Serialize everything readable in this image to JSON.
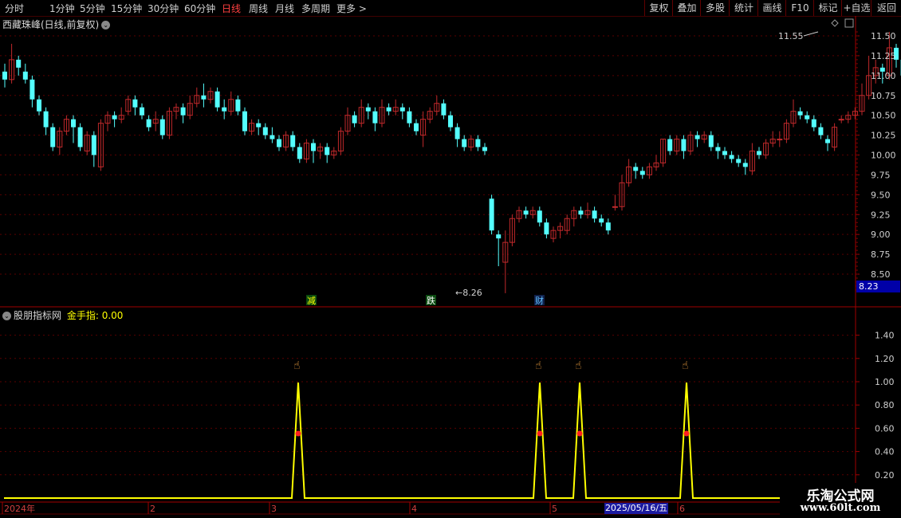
{
  "toolbar": {
    "periods": [
      "分时",
      "1分钟",
      "5分钟",
      "15分钟",
      "30分钟",
      "60分钟",
      "日线",
      "周线",
      "月线",
      "多周期",
      "更多 >"
    ],
    "active_period": "日线",
    "right_buttons": [
      "复权",
      "叠加",
      "多股",
      "统计",
      "画线",
      "F10",
      "标记",
      "+自选",
      "返回"
    ]
  },
  "main_chart": {
    "title": "西藏珠峰(日线,前复权)",
    "y_ticks": [
      "11.50",
      "11.25",
      "11.00",
      "10.75",
      "10.50",
      "10.25",
      "10.00",
      "9.75",
      "9.50",
      "9.25",
      "9.00",
      "8.75",
      "8.50"
    ],
    "high_label": "11.55",
    "low_label": "8.26",
    "current_price": "8.23",
    "markers": [
      "减",
      "跌",
      "财"
    ]
  },
  "indicator": {
    "name": "股朋指标网",
    "value_label": "金手指: 0.00",
    "y_ticks": [
      "1.40",
      "1.20",
      "1.00",
      "0.80",
      "0.60",
      "0.40",
      "0.20"
    ]
  },
  "time_axis": {
    "labels": [
      "2024年",
      "2",
      "3",
      "4",
      "5",
      "6"
    ],
    "cursor_date": "2025/05/16/五"
  },
  "watermark": {
    "line1": "乐淘公式网",
    "line2": "www.60lt.com"
  },
  "chart_data": {
    "type": "candlestick",
    "title": "西藏珠峰(日线,前复权)",
    "ylim": [
      8.23,
      11.6
    ],
    "candles": [
      [
        11.05,
        10.95,
        11.15,
        10.85
      ],
      [
        10.95,
        11.2,
        11.4,
        10.9
      ],
      [
        11.2,
        11.1,
        11.25,
        11.0
      ],
      [
        11.05,
        10.95,
        11.15,
        10.9
      ],
      [
        10.95,
        10.7,
        11.0,
        10.6
      ],
      [
        10.7,
        10.55,
        10.75,
        10.5
      ],
      [
        10.55,
        10.35,
        10.6,
        10.25
      ],
      [
        10.35,
        10.1,
        10.4,
        10.05
      ],
      [
        10.1,
        10.3,
        10.35,
        10.0
      ],
      [
        10.3,
        10.45,
        10.5,
        10.25
      ],
      [
        10.45,
        10.35,
        10.5,
        10.15
      ],
      [
        10.35,
        10.1,
        10.4,
        10.05
      ],
      [
        10.05,
        10.25,
        10.3,
        10.0
      ],
      [
        10.25,
        10.0,
        10.3,
        9.85
      ],
      [
        9.85,
        10.4,
        10.45,
        9.8
      ],
      [
        10.4,
        10.5,
        10.55,
        10.3
      ],
      [
        10.5,
        10.45,
        10.55,
        10.35
      ],
      [
        10.45,
        10.5,
        10.6,
        10.4
      ],
      [
        10.55,
        10.7,
        10.75,
        10.5
      ],
      [
        10.7,
        10.6,
        10.75,
        10.5
      ],
      [
        10.6,
        10.5,
        10.65,
        10.45
      ],
      [
        10.45,
        10.35,
        10.5,
        10.3
      ],
      [
        10.4,
        10.45,
        10.55,
        10.3
      ],
      [
        10.45,
        10.25,
        10.5,
        10.2
      ],
      [
        10.25,
        10.55,
        10.6,
        10.2
      ],
      [
        10.55,
        10.6,
        10.65,
        10.45
      ],
      [
        10.6,
        10.5,
        10.65,
        10.4
      ],
      [
        10.5,
        10.65,
        10.75,
        10.45
      ],
      [
        10.65,
        10.75,
        10.85,
        10.6
      ],
      [
        10.75,
        10.7,
        10.9,
        10.6
      ],
      [
        10.7,
        10.8,
        10.85,
        10.65
      ],
      [
        10.8,
        10.6,
        10.85,
        10.55
      ],
      [
        10.6,
        10.55,
        10.7,
        10.45
      ],
      [
        10.55,
        10.7,
        10.8,
        10.5
      ],
      [
        10.7,
        10.55,
        10.75,
        10.5
      ],
      [
        10.55,
        10.3,
        10.6,
        10.25
      ],
      [
        10.3,
        10.4,
        10.45,
        10.25
      ],
      [
        10.4,
        10.35,
        10.45,
        10.25
      ],
      [
        10.35,
        10.25,
        10.4,
        10.2
      ],
      [
        10.25,
        10.2,
        10.35,
        10.15
      ],
      [
        10.2,
        10.1,
        10.25,
        10.05
      ],
      [
        10.1,
        10.25,
        10.3,
        10.05
      ],
      [
        10.25,
        10.1,
        10.3,
        10.05
      ],
      [
        10.1,
        9.95,
        10.15,
        9.9
      ],
      [
        9.95,
        10.15,
        10.2,
        9.9
      ],
      [
        10.15,
        10.05,
        10.2,
        9.9
      ],
      [
        10.05,
        10.1,
        10.15,
        9.95
      ],
      [
        10.1,
        10.0,
        10.15,
        9.9
      ],
      [
        10.0,
        10.05,
        10.1,
        9.95
      ],
      [
        10.05,
        10.3,
        10.35,
        10.0
      ],
      [
        10.3,
        10.5,
        10.6,
        10.25
      ],
      [
        10.5,
        10.4,
        10.55,
        10.35
      ],
      [
        10.4,
        10.6,
        10.7,
        10.35
      ],
      [
        10.6,
        10.55,
        10.65,
        10.45
      ],
      [
        10.55,
        10.4,
        10.6,
        10.3
      ],
      [
        10.4,
        10.6,
        10.7,
        10.35
      ],
      [
        10.6,
        10.55,
        10.65,
        10.5
      ],
      [
        10.55,
        10.6,
        10.7,
        10.5
      ],
      [
        10.6,
        10.55,
        10.65,
        10.45
      ],
      [
        10.55,
        10.4,
        10.6,
        10.35
      ],
      [
        10.4,
        10.3,
        10.45,
        10.25
      ],
      [
        10.25,
        10.45,
        10.55,
        10.1
      ],
      [
        10.45,
        10.55,
        10.6,
        10.4
      ],
      [
        10.55,
        10.65,
        10.75,
        10.5
      ],
      [
        10.65,
        10.5,
        10.7,
        10.45
      ],
      [
        10.5,
        10.35,
        10.55,
        10.3
      ],
      [
        10.35,
        10.2,
        10.4,
        10.1
      ],
      [
        10.2,
        10.1,
        10.25,
        10.05
      ],
      [
        10.1,
        10.2,
        10.25,
        10.05
      ],
      [
        10.2,
        10.1,
        10.25,
        10.05
      ],
      [
        10.1,
        10.05,
        10.15,
        10.0
      ],
      [
        9.45,
        9.05,
        9.5,
        9.0
      ],
      [
        9.0,
        8.95,
        9.05,
        8.6
      ],
      [
        8.65,
        8.9,
        9.05,
        8.26
      ],
      [
        8.9,
        9.2,
        9.25,
        8.85
      ],
      [
        9.2,
        9.3,
        9.35,
        9.15
      ],
      [
        9.3,
        9.25,
        9.35,
        9.2
      ],
      [
        9.25,
        9.3,
        9.35,
        9.2
      ],
      [
        9.3,
        9.15,
        9.35,
        9.1
      ],
      [
        9.15,
        9.0,
        9.2,
        8.95
      ],
      [
        8.95,
        9.05,
        9.1,
        8.9
      ],
      [
        9.05,
        9.1,
        9.15,
        8.95
      ],
      [
        9.05,
        9.2,
        9.25,
        9.0
      ],
      [
        9.2,
        9.3,
        9.35,
        9.1
      ],
      [
        9.3,
        9.25,
        9.35,
        9.2
      ],
      [
        9.25,
        9.3,
        9.4,
        9.2
      ],
      [
        9.3,
        9.2,
        9.35,
        9.15
      ],
      [
        9.2,
        9.15,
        9.25,
        9.1
      ],
      [
        9.15,
        9.05,
        9.2,
        9.0
      ],
      [
        9.35,
        9.35,
        9.5,
        9.3
      ],
      [
        9.35,
        9.65,
        9.75,
        9.3
      ],
      [
        9.65,
        9.85,
        9.95,
        9.6
      ],
      [
        9.85,
        9.8,
        9.9,
        9.7
      ],
      [
        9.8,
        9.75,
        9.85,
        9.7
      ],
      [
        9.75,
        9.85,
        9.9,
        9.7
      ],
      [
        9.85,
        9.9,
        10.0,
        9.8
      ],
      [
        9.9,
        10.2,
        10.2,
        9.85
      ],
      [
        10.2,
        10.05,
        10.25,
        10.0
      ],
      [
        10.05,
        10.2,
        10.25,
        10.0
      ],
      [
        10.2,
        10.05,
        10.25,
        9.95
      ],
      [
        10.05,
        10.25,
        10.3,
        10.0
      ],
      [
        10.25,
        10.2,
        10.3,
        10.1
      ],
      [
        10.2,
        10.25,
        10.3,
        10.15
      ],
      [
        10.25,
        10.1,
        10.3,
        10.05
      ],
      [
        10.1,
        10.05,
        10.15,
        9.95
      ],
      [
        10.05,
        10.0,
        10.1,
        9.95
      ],
      [
        10.0,
        9.95,
        10.05,
        9.9
      ],
      [
        9.95,
        9.9,
        10.0,
        9.85
      ],
      [
        9.9,
        9.85,
        9.95,
        9.75
      ],
      [
        9.8,
        10.05,
        10.15,
        9.75
      ],
      [
        10.05,
        10.0,
        10.1,
        9.95
      ],
      [
        10.0,
        10.15,
        10.2,
        9.95
      ],
      [
        10.15,
        10.2,
        10.3,
        10.1
      ],
      [
        10.2,
        10.2,
        10.3,
        10.1
      ],
      [
        10.2,
        10.4,
        10.45,
        10.15
      ],
      [
        10.4,
        10.55,
        10.7,
        10.35
      ],
      [
        10.55,
        10.5,
        10.6,
        10.45
      ],
      [
        10.5,
        10.45,
        10.55,
        10.4
      ],
      [
        10.45,
        10.35,
        10.5,
        10.3
      ],
      [
        10.35,
        10.25,
        10.4,
        10.2
      ],
      [
        10.2,
        10.15,
        10.25,
        10.05
      ],
      [
        10.1,
        10.35,
        10.4,
        10.05
      ],
      [
        10.45,
        10.45,
        10.5,
        10.4
      ],
      [
        10.45,
        10.5,
        10.55,
        10.4
      ],
      [
        10.5,
        10.55,
        10.6,
        10.45
      ],
      [
        10.55,
        10.75,
        10.9,
        10.5
      ],
      [
        10.75,
        11.0,
        11.25,
        10.7
      ],
      [
        11.0,
        11.1,
        11.2,
        10.9
      ],
      [
        11.1,
        11.05,
        11.15,
        10.9
      ],
      [
        11.0,
        11.35,
        11.55,
        10.95
      ],
      [
        11.35,
        11.2,
        11.4,
        11.1
      ],
      [
        11.2,
        11.0,
        11.25,
        10.95
      ]
    ]
  }
}
